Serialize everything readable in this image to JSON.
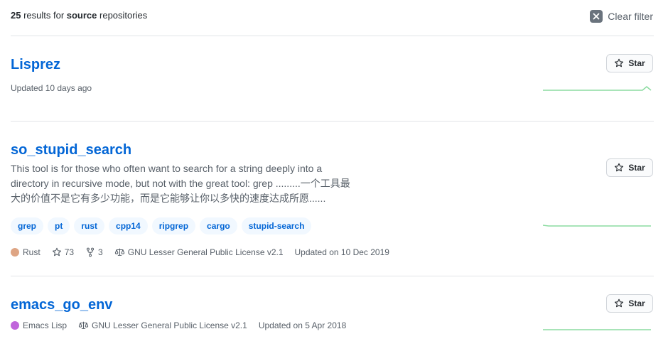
{
  "summary": {
    "count": "25",
    "text_middle": " results for ",
    "query": "source",
    "text_end": " repositories"
  },
  "clear_filter": {
    "label": "Clear filter",
    "icon": "close-icon"
  },
  "star_label": "Star",
  "repos": [
    {
      "name": "Lisprez",
      "updated": "Updated 10 days ago"
    },
    {
      "name": "so_stupid_search",
      "description_lines": [
        "This tool is for those who often want to search for a string deeply into a",
        "directory in recursive mode, but not with the great tool: grep .........一个工具最",
        "大的价值不是它有多少功能，而是它能够让你以多快的速度达成所愿......"
      ],
      "topics": [
        "grep",
        "pt",
        "rust",
        "cpp14",
        "ripgrep",
        "cargo",
        "stupid-search"
      ],
      "language": "Rust",
      "language_color": "#dea584",
      "stars": "73",
      "forks": "3",
      "license": "GNU Lesser General Public License v2.1",
      "updated": "Updated on 10 Dec 2019"
    },
    {
      "name": "emacs_go_env",
      "language": "Emacs Lisp",
      "language_color": "#c065db",
      "license": "GNU Lesser General Public License v2.1",
      "updated": "Updated on 5 Apr 2018"
    }
  ],
  "colors": {
    "link": "#0366d6",
    "sparkline": "#40c463",
    "muted": "#586069"
  }
}
